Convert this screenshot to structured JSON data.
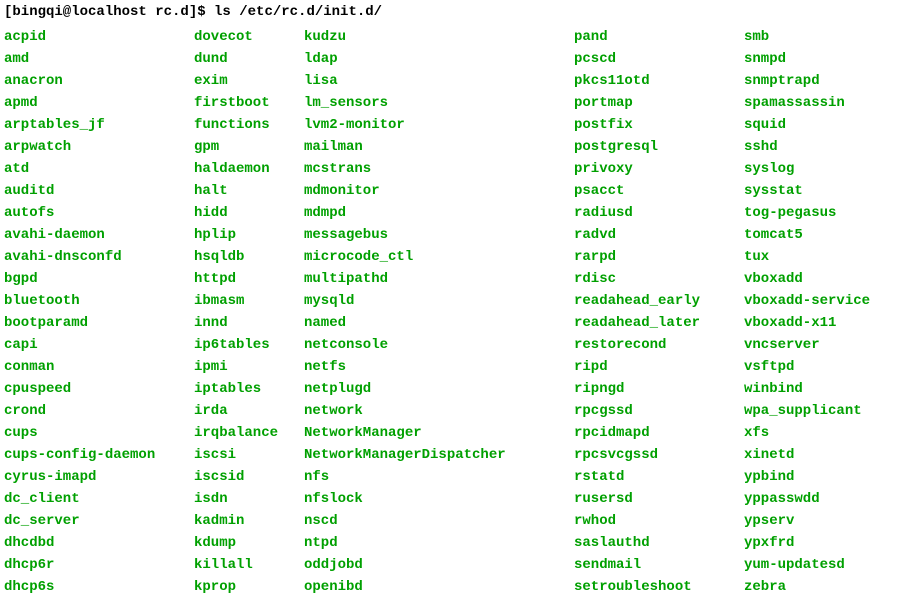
{
  "prompt": "[bingqi@localhost rc.d]$ ls /etc/rc.d/init.d/",
  "columns": [
    [
      "acpid",
      "amd",
      "anacron",
      "apmd",
      "arptables_jf",
      "arpwatch",
      "atd",
      "auditd",
      "autofs",
      "avahi-daemon",
      "avahi-dnsconfd",
      "bgpd",
      "bluetooth",
      "bootparamd",
      "capi",
      "conman",
      "cpuspeed",
      "crond",
      "cups",
      "cups-config-daemon",
      "cyrus-imapd",
      "dc_client",
      "dc_server",
      "dhcdbd",
      "dhcp6r",
      "dhcp6s"
    ],
    [
      "dovecot",
      "dund",
      "exim",
      "firstboot",
      "functions",
      "gpm",
      "haldaemon",
      "halt",
      "hidd",
      "hplip",
      "hsqldb",
      "httpd",
      "ibmasm",
      "innd",
      "ip6tables",
      "ipmi",
      "iptables",
      "irda",
      "irqbalance",
      "iscsi",
      "iscsid",
      "isdn",
      "kadmin",
      "kdump",
      "killall",
      "kprop"
    ],
    [
      "kudzu",
      "ldap",
      "lisa",
      "lm_sensors",
      "lvm2-monitor",
      "mailman",
      "mcstrans",
      "mdmonitor",
      "mdmpd",
      "messagebus",
      "microcode_ctl",
      "multipathd",
      "mysqld",
      "named",
      "netconsole",
      "netfs",
      "netplugd",
      "network",
      "NetworkManager",
      "NetworkManagerDispatcher",
      "nfs",
      "nfslock",
      "nscd",
      "ntpd",
      "oddjobd",
      "openibd"
    ],
    [
      "pand",
      "pcscd",
      "pkcs11otd",
      "portmap",
      "postfix",
      "postgresql",
      "privoxy",
      "psacct",
      "radiusd",
      "radvd",
      "rarpd",
      "rdisc",
      "readahead_early",
      "readahead_later",
      "restorecond",
      "ripd",
      "ripngd",
      "rpcgssd",
      "rpcidmapd",
      "rpcsvcgssd",
      "rstatd",
      "rusersd",
      "rwhod",
      "saslauthd",
      "sendmail",
      "setroubleshoot"
    ],
    [
      "smb",
      "snmpd",
      "snmptrapd",
      "spamassassin",
      "squid",
      "sshd",
      "syslog",
      "sysstat",
      "tog-pegasus",
      "tomcat5",
      "tux",
      "vboxadd",
      "vboxadd-service",
      "vboxadd-x11",
      "vncserver",
      "vsftpd",
      "winbind",
      "wpa_supplicant",
      "xfs",
      "xinetd",
      "ypbind",
      "yppasswdd",
      "ypserv",
      "ypxfrd",
      "yum-updatesd",
      "zebra"
    ]
  ]
}
